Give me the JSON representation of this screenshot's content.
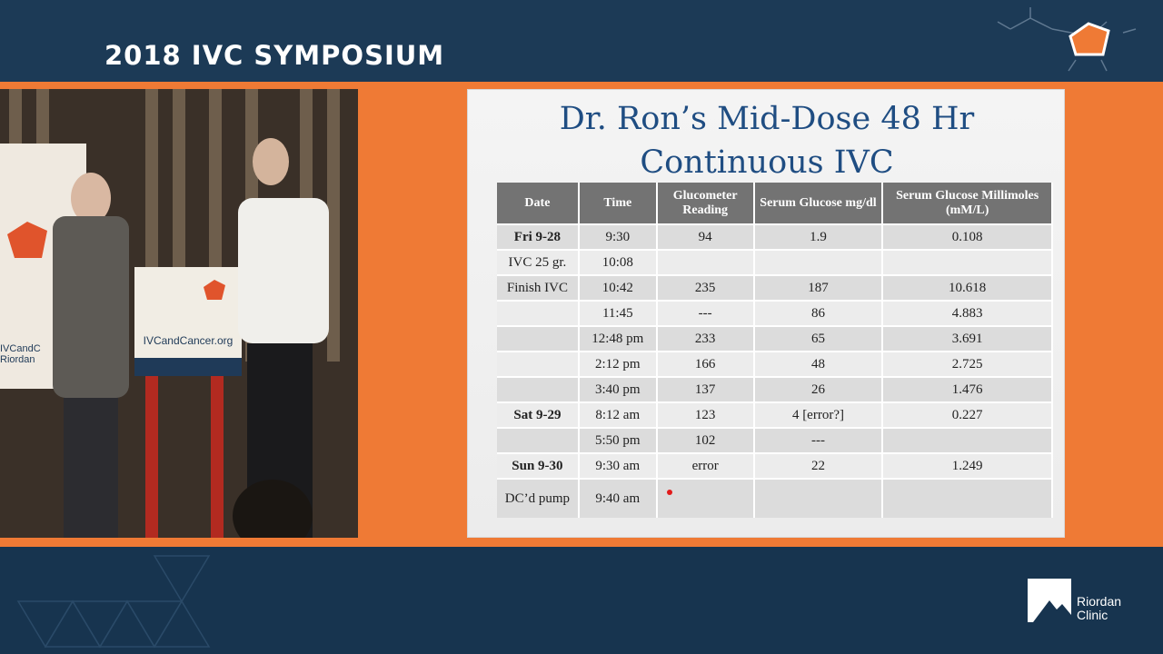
{
  "event": {
    "title": "2018 IVC SYMPOSIUM"
  },
  "video": {
    "banner_text": "IVCandCancer.org",
    "side_text_1": "IVCandC",
    "side_text_2": "Riordan"
  },
  "slide": {
    "title_line1": "Dr. Ron’s Mid-Dose 48 Hr",
    "title_line2": "Continuous IVC",
    "headers": [
      "Date",
      "Time",
      "Glucometer Reading",
      "Serum Glucose mg/dl",
      "Serum Glucose Millimoles (mM/L)"
    ],
    "rows": [
      {
        "date": "Fri 9-28",
        "date_bold": true,
        "time": "9:30",
        "glucometer": "94",
        "serum_mgdl": "1.9",
        "serum_mm": "0.108",
        "shade": true
      },
      {
        "date": "IVC 25 gr.",
        "date_bold": false,
        "time": "10:08",
        "glucometer": "",
        "serum_mgdl": "",
        "serum_mm": "",
        "shade": false
      },
      {
        "date": "Finish IVC",
        "date_bold": false,
        "time": "10:42",
        "glucometer": "235",
        "serum_mgdl": "187",
        "serum_mm": "10.618",
        "shade": true
      },
      {
        "date": "",
        "date_bold": false,
        "time": "11:45",
        "glucometer": "---",
        "serum_mgdl": "86",
        "serum_mm": "4.883",
        "shade": false
      },
      {
        "date": "",
        "date_bold": false,
        "time": "12:48 pm",
        "glucometer": "233",
        "serum_mgdl": "65",
        "serum_mm": "3.691",
        "shade": true
      },
      {
        "date": "",
        "date_bold": false,
        "time": "2:12 pm",
        "glucometer": "166",
        "serum_mgdl": "48",
        "serum_mm": "2.725",
        "shade": false
      },
      {
        "date": "",
        "date_bold": false,
        "time": "3:40 pm",
        "glucometer": "137",
        "serum_mgdl": "26",
        "serum_mm": "1.476",
        "shade": true
      },
      {
        "date": "Sat 9-29",
        "date_bold": true,
        "time": "8:12 am",
        "glucometer": "123",
        "serum_mgdl": "4   [error?]",
        "serum_mm": "0.227",
        "shade": false
      },
      {
        "date": "",
        "date_bold": false,
        "time": "5:50 pm",
        "glucometer": "102",
        "serum_mgdl": "---",
        "serum_mm": "",
        "shade": true
      },
      {
        "date": "Sun 9-30",
        "date_bold": true,
        "time": "9:30 am",
        "glucometer": "error",
        "serum_mgdl": "22",
        "serum_mm": "1.249",
        "shade": false
      },
      {
        "date": "DC’d pump",
        "date_bold": false,
        "time": "9:40 am",
        "glucometer": "",
        "serum_mgdl": "",
        "serum_mm": "",
        "shade": true,
        "tall": true
      }
    ]
  },
  "brand": {
    "name_line1": "Riordan",
    "name_line2": "Clinic"
  },
  "colors": {
    "navy": "#1c3a56",
    "orange": "#ef7a35",
    "title_blue": "#1f4d82",
    "header_gray": "#737373"
  }
}
